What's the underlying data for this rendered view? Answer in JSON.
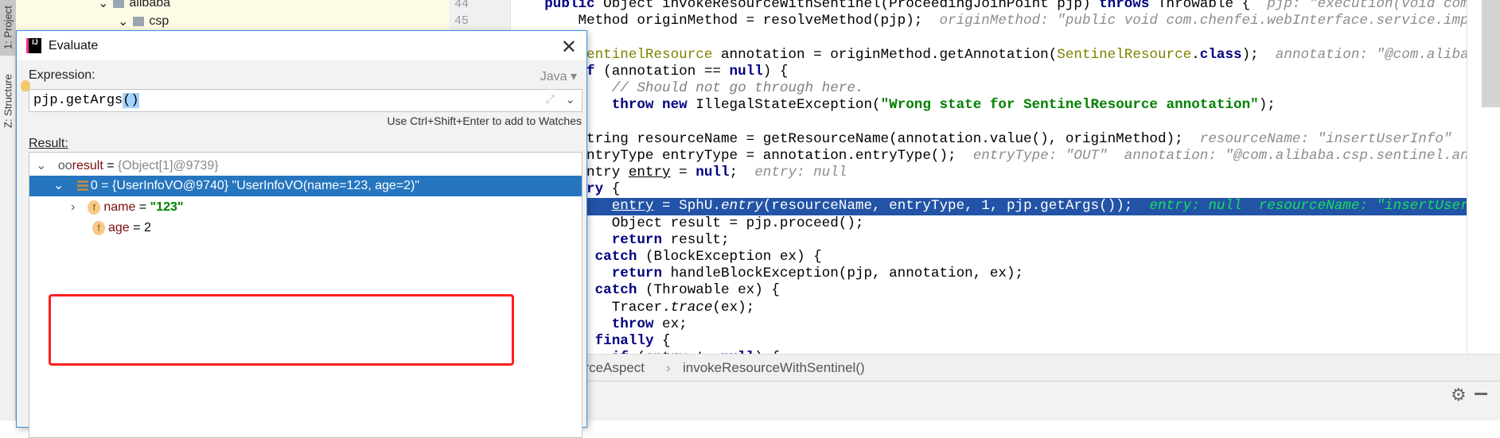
{
  "left_strip": {
    "project_tab": "1: Project",
    "structure_tab": "Z: Structure"
  },
  "project_tree": [
    {
      "label": "alibaba"
    },
    {
      "label": "csp"
    }
  ],
  "line_numbers": [
    "44",
    "45"
  ],
  "code_lines": [
    [
      {
        "t": "    "
      },
      {
        "t": "public",
        "k": "kw"
      },
      {
        "t": " Object invokeResourceWithSentinel(ProceedingJoinPoint pjp) "
      },
      {
        "t": "throws",
        "k": "kw"
      },
      {
        "t": " Throwable {  "
      },
      {
        "t": "pjp: \"execution(void com.chenfei.webInterface",
        "k": "hint"
      }
    ],
    [
      {
        "t": "        Method originMethod = resolveMethod(pjp);  "
      },
      {
        "t": "originMethod: \"public void com.chenfei.webInterface.service.impl.UserServ",
        "k": "hint"
      }
    ],
    [],
    [
      {
        "t": "        "
      },
      {
        "t": "SentinelResource",
        "k": "ann"
      },
      {
        "t": " annotation = originMethod.getAnnotation("
      },
      {
        "t": "SentinelResource",
        "k": "ann"
      },
      {
        "t": "."
      },
      {
        "t": "class",
        "k": "kw"
      },
      {
        "t": ");  "
      },
      {
        "t": "annotation: \"@com.alibaba.csp.sentinel",
        "k": "hint"
      }
    ],
    [
      {
        "t": "        "
      },
      {
        "t": "if",
        "k": "kw"
      },
      {
        "t": " (annotation == "
      },
      {
        "t": "null",
        "k": "kw"
      },
      {
        "t": ") {"
      }
    ],
    [
      {
        "t": "            "
      },
      {
        "t": "// Should not go through here.",
        "k": "com"
      }
    ],
    [
      {
        "t": "            "
      },
      {
        "t": "throw new",
        "k": "kw"
      },
      {
        "t": " IllegalStateException("
      },
      {
        "t": "\"Wrong state for SentinelResource annotation\"",
        "k": "str"
      },
      {
        "t": ");"
      }
    ],
    [
      {
        "t": "        }"
      }
    ],
    [
      {
        "t": "        String resourceName = getResourceName(annotation.value(), originMethod);  "
      },
      {
        "t": "resourceName: \"insertUserInfo\"  originMethod",
        "k": "hint"
      }
    ],
    [
      {
        "t": "        EntryType entryType = annotation.entryType();  "
      },
      {
        "t": "entryType: \"OUT\"  annotation: \"@com.alibaba.csp.sentinel.annotation.SentinelResource",
        "k": "hint"
      }
    ],
    [
      {
        "t": "        Entry "
      },
      {
        "t": "entry",
        "k": "ul"
      },
      {
        "t": " = "
      },
      {
        "t": "null",
        "k": "kw"
      },
      {
        "t": ";  "
      },
      {
        "t": "entry: null",
        "k": "hint"
      }
    ],
    [
      {
        "t": "        "
      },
      {
        "t": "try",
        "k": "kw"
      },
      {
        "t": " {"
      }
    ],
    [
      {
        "t": "            "
      },
      {
        "t": "entry",
        "k": "ul"
      },
      {
        "t": " = SphU."
      },
      {
        "t": "entry",
        "k": "it"
      },
      {
        "t": "(resourceName, entryType, 1, pjp.getArgs());  "
      },
      {
        "t": "entry: null  resourceName: \"insertUserInfo\"  entryType",
        "k": "hint"
      }
    ],
    [
      {
        "t": "            Object result = pjp.proceed();"
      }
    ],
    [
      {
        "t": "            "
      },
      {
        "t": "return",
        "k": "kw"
      },
      {
        "t": " result;"
      }
    ],
    [
      {
        "t": "        } "
      },
      {
        "t": "catch",
        "k": "kw"
      },
      {
        "t": " (BlockException ex) {"
      }
    ],
    [
      {
        "t": "            "
      },
      {
        "t": "return",
        "k": "kw"
      },
      {
        "t": " handleBlockException(pjp, annotation, ex);"
      }
    ],
    [
      {
        "t": "        } "
      },
      {
        "t": "catch",
        "k": "kw"
      },
      {
        "t": " (Throwable ex) {"
      }
    ],
    [
      {
        "t": "            Tracer."
      },
      {
        "t": "trace",
        "k": "it"
      },
      {
        "t": "(ex);"
      }
    ],
    [
      {
        "t": "            "
      },
      {
        "t": "throw",
        "k": "kw"
      },
      {
        "t": " ex;"
      }
    ],
    [
      {
        "t": "        } "
      },
      {
        "t": "finally",
        "k": "kw"
      },
      {
        "t": " {"
      }
    ],
    [
      {
        "t": "            "
      },
      {
        "t": "if",
        "k": "kw"
      },
      {
        "t": " (entry != "
      },
      {
        "t": "null",
        "k": "kw"
      },
      {
        "t": ") {"
      }
    ]
  ],
  "execution_line_index": 12,
  "breadcrumb": {
    "class": "SentinelResourceAspect",
    "separator": "›",
    "method": "invokeResourceWithSentinel()"
  },
  "bottom_icons": [
    "gear-icon",
    "minimize-icon"
  ],
  "dialog": {
    "title": "Evaluate",
    "close": "✕",
    "expression_label": "Expression:",
    "language": "Java ▾",
    "expression_main": "pjp.getArgs",
    "expression_selected": "()",
    "hint": "Use Ctrl+Shift+Enter to add to Watches",
    "result_label": "Result:",
    "result": {
      "root": {
        "name": "result",
        "eq": " = ",
        "value": "{Object[1]@9739}"
      },
      "item0": {
        "name": "0",
        "eq": " = ",
        "value": "{UserInfoVO@9740} \"UserInfoVO(name=123, age=2)\""
      },
      "field_name": {
        "name": "name",
        "eq": " = ",
        "value": "\"123\""
      },
      "field_age": {
        "name": "age",
        "eq": " = ",
        "value": "2"
      }
    }
  },
  "colors": {
    "selection": "#2675bf",
    "execution_line": "#2353a6",
    "highlight_box": "#ff2020"
  }
}
